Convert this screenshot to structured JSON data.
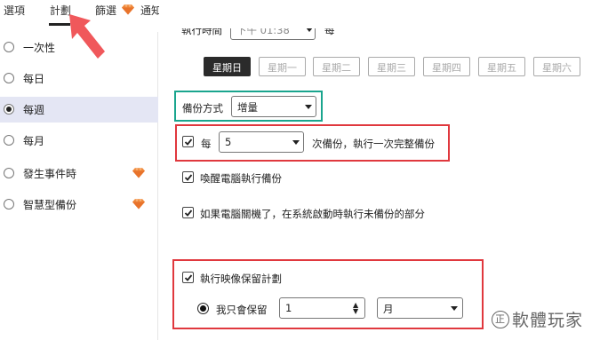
{
  "tabs": [
    {
      "label": "選項"
    },
    {
      "label": "計劃"
    },
    {
      "label": "篩選"
    },
    {
      "label": "通知"
    }
  ],
  "sidebar": {
    "items": [
      {
        "label": "一次性",
        "selected": false,
        "premium": false
      },
      {
        "label": "每日",
        "selected": false,
        "premium": false
      },
      {
        "label": "每週",
        "selected": true,
        "premium": false
      },
      {
        "label": "每月",
        "selected": false,
        "premium": false
      },
      {
        "label": "發生事件時",
        "selected": false,
        "premium": true
      },
      {
        "label": "智慧型備份",
        "selected": false,
        "premium": true
      }
    ]
  },
  "schedule": {
    "time_label": "執行時間",
    "time_value": "下午 01:38",
    "every_label": "每",
    "days": [
      "星期日",
      "星期一",
      "星期二",
      "星期三",
      "星期四",
      "星期五",
      "星期六"
    ],
    "active_day": "星期日"
  },
  "backup_method": {
    "label": "備份方式",
    "value": "增量"
  },
  "full_backup": {
    "prefix": "每",
    "value": "5",
    "suffix": "次備份，執行一次完整備份",
    "checked": true
  },
  "options": [
    {
      "label": "喚醒電腦執行備份",
      "checked": true
    },
    {
      "label": "如果電腦關機了，在系統啟動時執行未備份的部分",
      "checked": true
    }
  ],
  "retention": {
    "label": "執行映像保留計劃",
    "checked": true,
    "radio_label": "我只會保留",
    "count_value": "1",
    "unit_value": "月"
  },
  "watermark": {
    "logo_text": "正",
    "text": "軟體玩家"
  },
  "colors": {
    "highlight_green": "#1aa58e",
    "highlight_red": "#e0383e",
    "arrow_red": "#f0585b",
    "premium_gem": "#f08a3c",
    "selected_row": "#e4e6f4"
  }
}
